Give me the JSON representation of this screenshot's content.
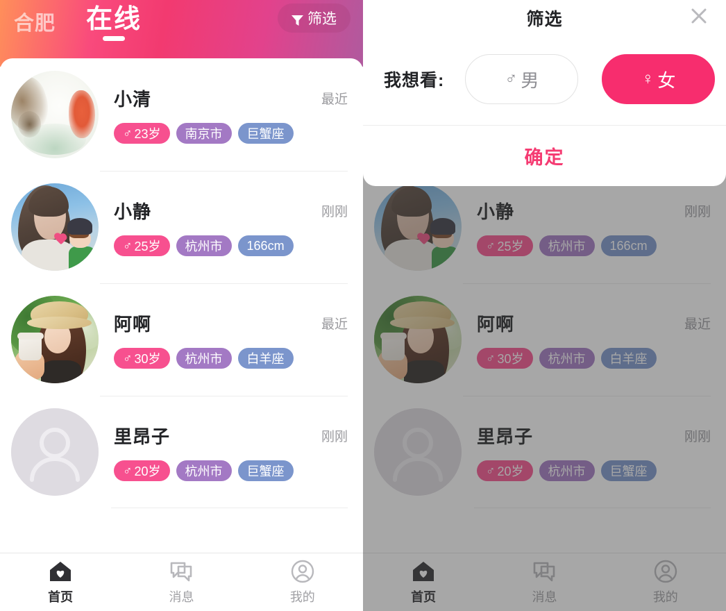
{
  "header": {
    "city": "合肥",
    "title": "在线",
    "filter_button": "筛选",
    "filter_icon": "funnel-icon",
    "gradient_from": "#ff8f5a",
    "gradient_mid": "#f23a70",
    "gradient_to": "#b05a9e"
  },
  "list": {
    "items": [
      {
        "name": "小清",
        "time": "最近",
        "avatar": "watercolor-illustration-avatar",
        "tags": [
          {
            "icon": "male-symbol",
            "label": "23岁",
            "color": "#f7508f"
          },
          {
            "icon": "",
            "label": "南京市",
            "color": "#a379c4"
          },
          {
            "icon": "",
            "label": "巨蟹座",
            "color": "#7b95cc"
          }
        ]
      },
      {
        "name": "小静",
        "time": "刚刚",
        "avatar": "girl-sky-photo-avatar",
        "tags": [
          {
            "icon": "male-symbol",
            "label": "25岁",
            "color": "#f7508f"
          },
          {
            "icon": "",
            "label": "杭州市",
            "color": "#a379c4"
          },
          {
            "icon": "",
            "label": "166cm",
            "color": "#7b95cc"
          }
        ]
      },
      {
        "name": "阿啊",
        "time": "最近",
        "avatar": "woman-straw-hat-photo-avatar",
        "tags": [
          {
            "icon": "male-symbol",
            "label": "30岁",
            "color": "#f7508f"
          },
          {
            "icon": "",
            "label": "杭州市",
            "color": "#a379c4"
          },
          {
            "icon": "",
            "label": "白羊座",
            "color": "#7b95cc"
          }
        ]
      },
      {
        "name": "里昂子",
        "time": "刚刚",
        "avatar": "default-person-placeholder-avatar",
        "tags": [
          {
            "icon": "male-symbol",
            "label": "20岁",
            "color": "#f7508f"
          },
          {
            "icon": "",
            "label": "杭州市",
            "color": "#a379c4"
          },
          {
            "icon": "",
            "label": "巨蟹座",
            "color": "#7b95cc"
          }
        ]
      }
    ]
  },
  "tabbar": {
    "items": [
      {
        "label": "首页",
        "icon": "home-heart-icon",
        "active": true
      },
      {
        "label": "消息",
        "icon": "chat-bubbles-icon",
        "active": false
      },
      {
        "label": "我的",
        "icon": "person-circle-icon",
        "active": false
      }
    ]
  },
  "filter_modal": {
    "title": "筛选",
    "close_icon": "close-icon",
    "want_label": "我想看:",
    "options": [
      {
        "label": "男",
        "icon": "male-symbol",
        "selected": false
      },
      {
        "label": "女",
        "icon": "female-symbol",
        "selected": true
      }
    ],
    "confirm_label": "确定",
    "accent_color": "#f72d6e"
  },
  "symbols": {
    "male": "♂",
    "female": "♀",
    "close": "✕"
  }
}
